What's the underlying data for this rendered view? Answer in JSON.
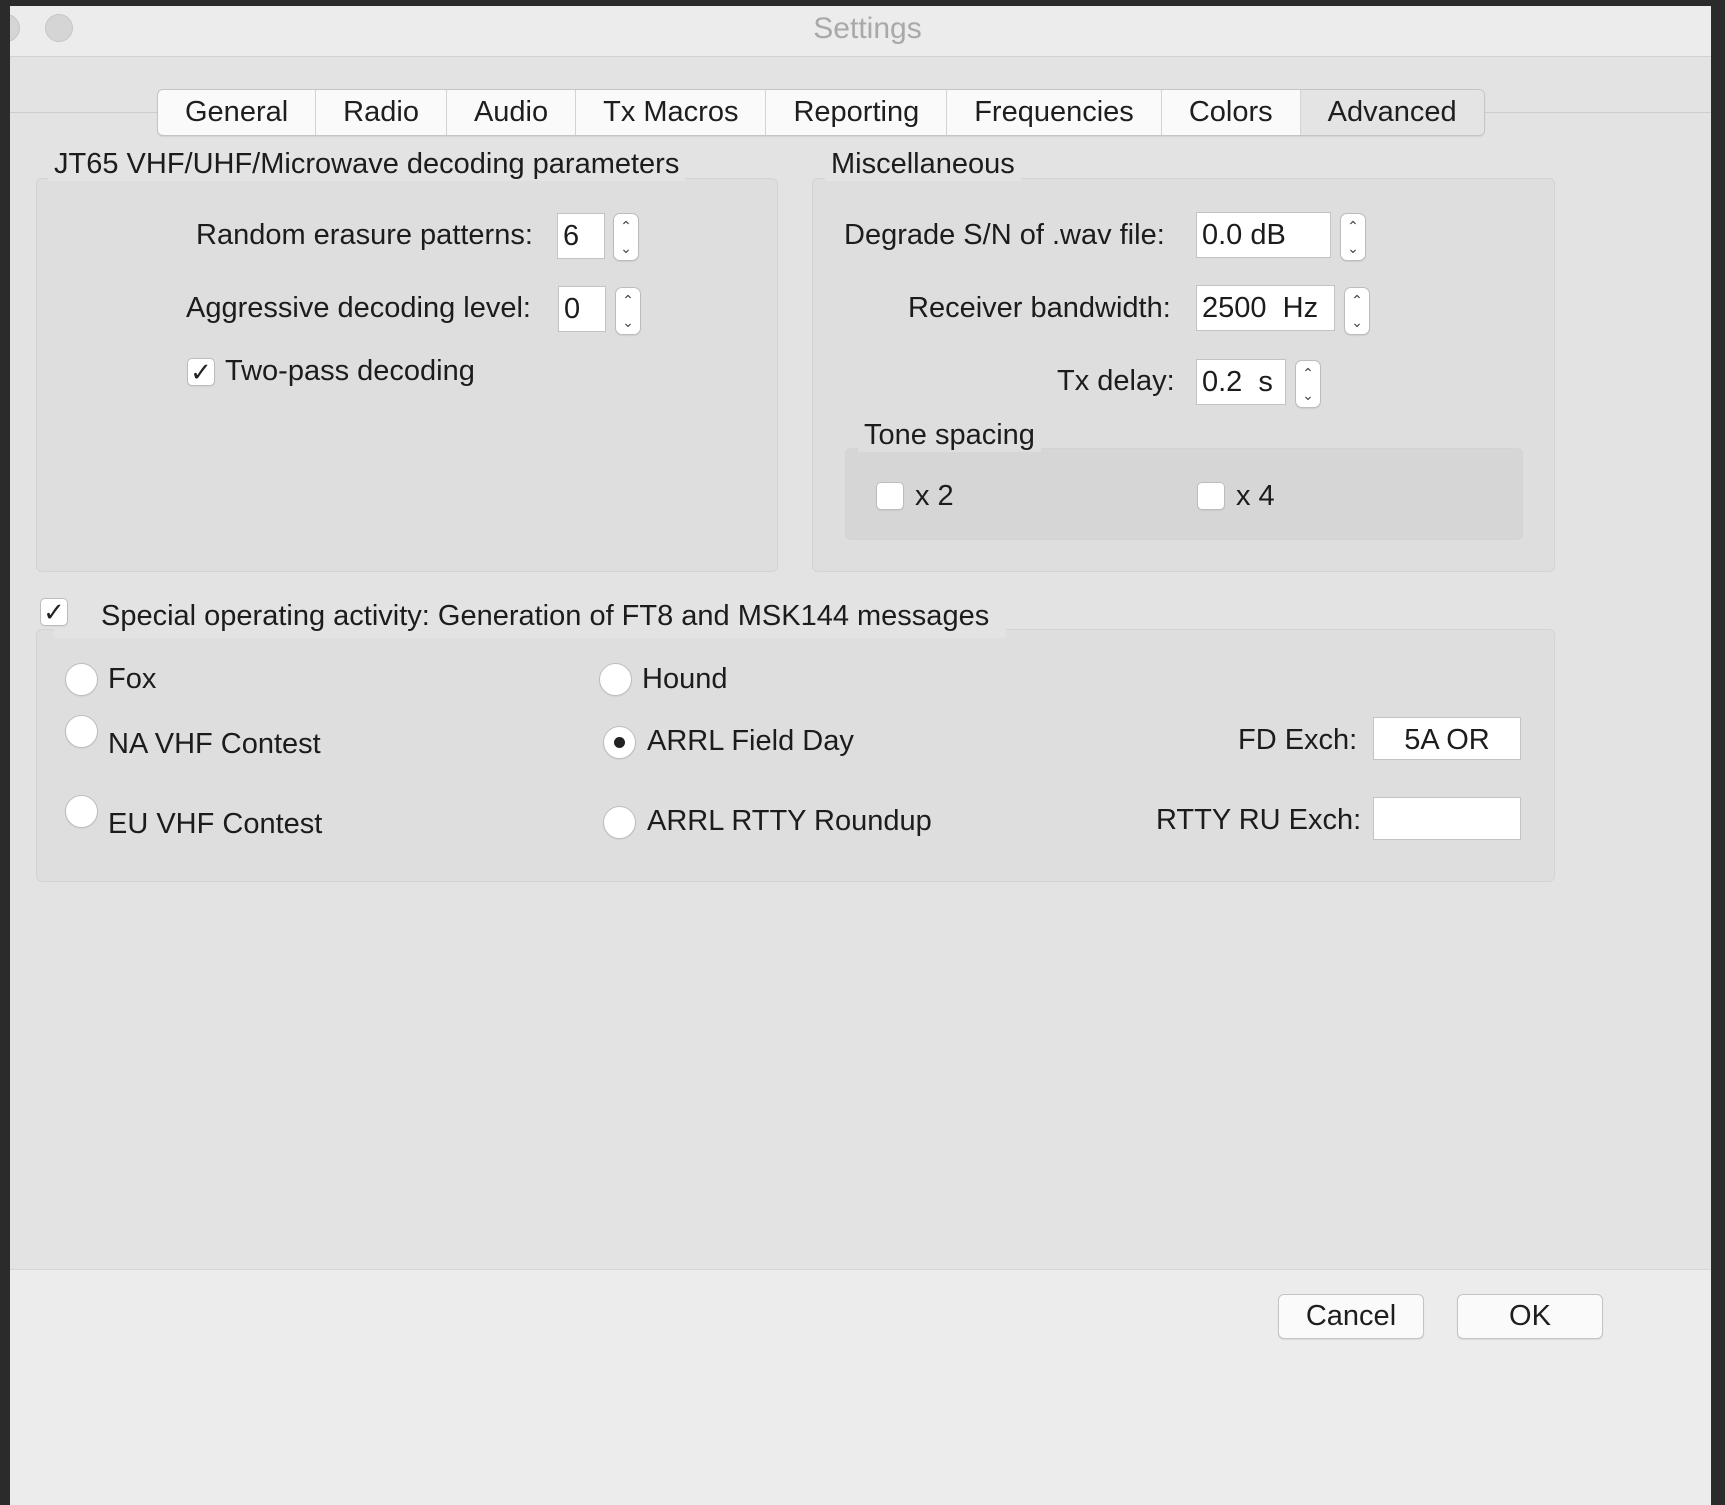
{
  "window": {
    "title": "Settings"
  },
  "tabs": [
    "General",
    "Radio",
    "Audio",
    "Tx Macros",
    "Reporting",
    "Frequencies",
    "Colors",
    "Advanced"
  ],
  "active_tab": "Advanced",
  "jt65": {
    "title": "JT65 VHF/UHF/Microwave decoding parameters",
    "random_erasure_label": "Random erasure patterns:",
    "random_erasure_value": "6",
    "aggressive_label": "Aggressive decoding level:",
    "aggressive_value": "0",
    "two_pass_label": "Two-pass decoding",
    "two_pass_checked": true
  },
  "misc": {
    "title": "Miscellaneous",
    "degrade_label": "Degrade S/N of .wav file:",
    "degrade_value": "0.0 dB",
    "bandwidth_label": "Receiver bandwidth:",
    "bandwidth_value": "2500  Hz",
    "txdelay_label": "Tx delay:",
    "txdelay_value": "0.2  s",
    "tone_spacing": {
      "title": "Tone spacing",
      "x2_label": "x 2",
      "x2_checked": false,
      "x4_label": "x 4",
      "x4_checked": false
    }
  },
  "special": {
    "title": "Special operating activity:  Generation of FT8 and MSK144 messages",
    "enabled": true,
    "fox": "Fox",
    "hound": "Hound",
    "na_vhf": "NA VHF Contest",
    "arrl_fd": "ARRL Field Day",
    "eu_vhf": "EU VHF Contest",
    "arrl_rtty": "ARRL RTTY Roundup",
    "selected": "ARRL Field Day",
    "fd_exch_label": "FD Exch:",
    "fd_exch_value": "5A OR",
    "rtty_exch_label": "RTTY RU Exch:",
    "rtty_exch_value": ""
  },
  "buttons": {
    "cancel": "Cancel",
    "ok": "OK"
  },
  "icons": {
    "spinner_up": "chevron-up-icon",
    "spinner_down": "chevron-down-icon",
    "check": "checkmark-icon"
  }
}
